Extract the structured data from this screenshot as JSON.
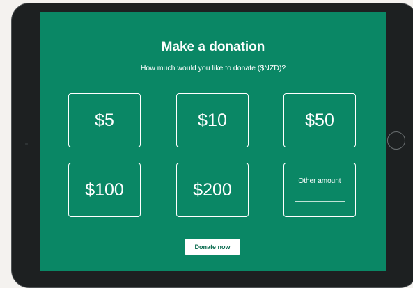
{
  "donation": {
    "title": "Make a donation",
    "subtitle": "How much would you like to donate ($NZD)?",
    "amounts": [
      "$5",
      "$10",
      "$50",
      "$100",
      "$200"
    ],
    "other_amount_label": "Other amount",
    "other_amount_value": "",
    "donate_button": "Donate now"
  },
  "colors": {
    "screen_background": "#0a8765",
    "tablet_frame": "#1d2021",
    "text": "#ffffff",
    "button_background": "#ffffff",
    "button_text": "#0a6b4f"
  }
}
